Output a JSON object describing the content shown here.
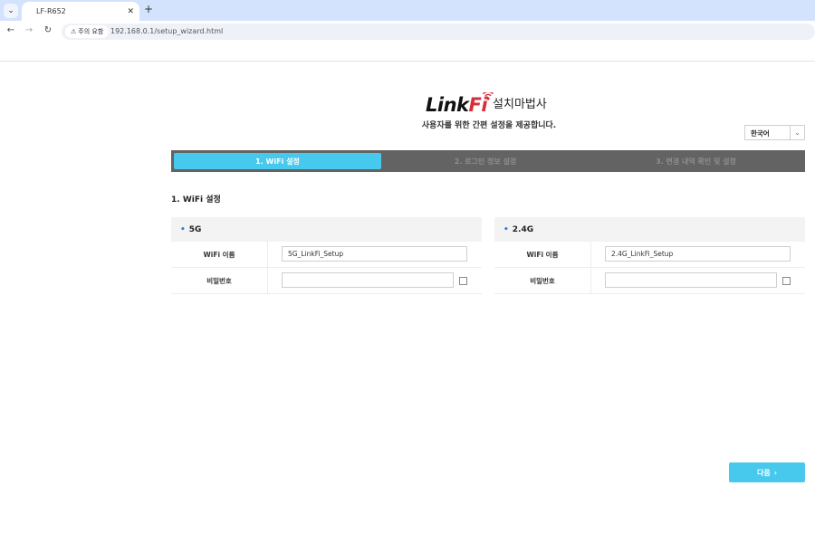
{
  "browser": {
    "tab_title": "LF-R652",
    "tab_close": "✕",
    "new_tab": "+",
    "security_label": "주의 요함",
    "url": "192.168.0.1/setup_wizard.html"
  },
  "header": {
    "logo_link": "Link",
    "logo_fi": "Fi",
    "title": "설치마법사",
    "subtitle": "사용자를 위한 간편 설정을 제공합니다."
  },
  "language": {
    "selected": "한국어"
  },
  "steps": [
    {
      "label": "1. WiFi 설정",
      "active": true
    },
    {
      "label": "2. 로그인 정보 설정",
      "active": false
    },
    {
      "label": "3. 변경 내역 확인 및 설정",
      "active": false
    }
  ],
  "section_title": "1. WiFi 설정",
  "bands": [
    {
      "name": "5G",
      "ssid_label": "WiFi 이름",
      "ssid_value": "5G_LinkFi_Setup",
      "password_label": "비밀번호",
      "password_value": ""
    },
    {
      "name": "2.4G",
      "ssid_label": "WiFi 이름",
      "ssid_value": "2.4G_LinkFi_Setup",
      "password_label": "비밀번호",
      "password_value": ""
    }
  ],
  "next_button": {
    "label": "다음",
    "arrow": "›"
  },
  "colors": {
    "accent": "#47c9ee",
    "step_bar": "#636363",
    "logo_red": "#d62f3c"
  }
}
